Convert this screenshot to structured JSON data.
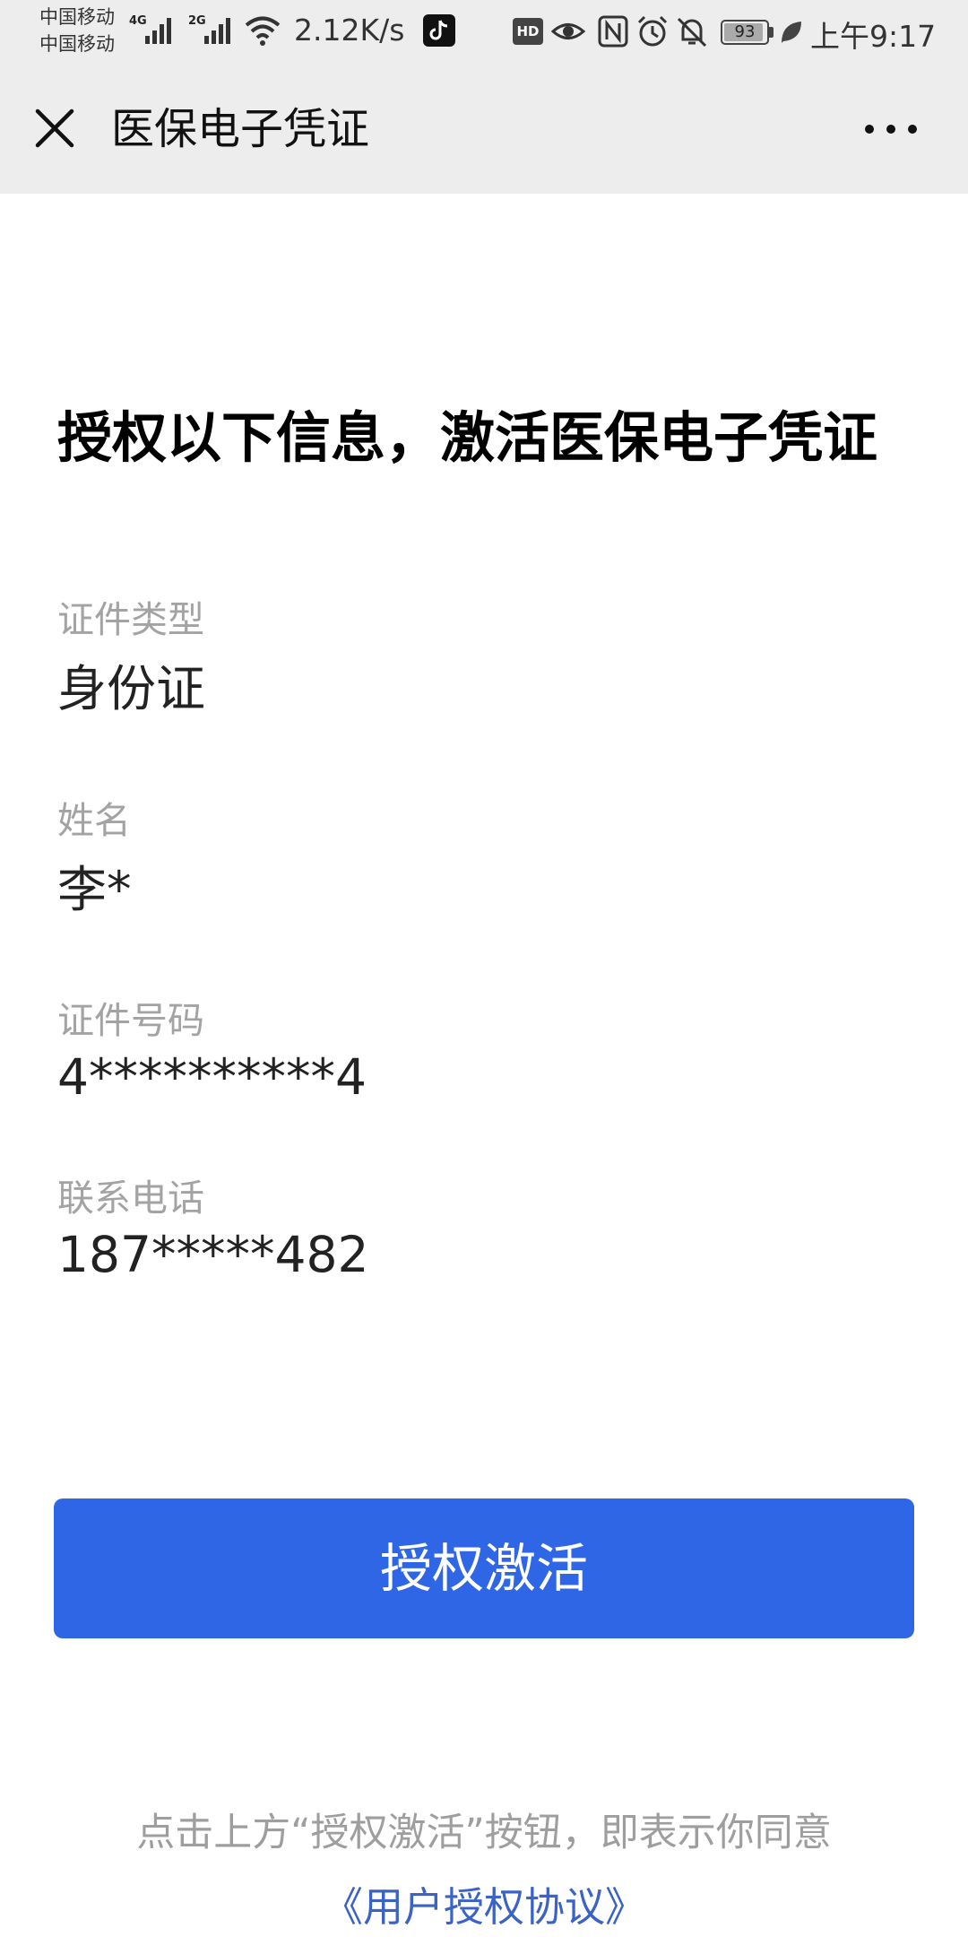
{
  "status_bar": {
    "carrier_1": "中国移动",
    "carrier_2": "中国移动",
    "network_1": "4G",
    "network_2": "2G",
    "speed": "2.12K/s",
    "hd_label": "HD",
    "battery_level": "93",
    "battery_fraction": 0.93,
    "time": "上午9:17",
    "icons": [
      "signal-icon",
      "wifi-icon",
      "tiktok-icon",
      "hd-icon",
      "eye-icon",
      "nfc-icon",
      "alarm-icon",
      "mute-icon",
      "battery-icon",
      "leaf-icon"
    ]
  },
  "nav": {
    "title": "医保电子凭证",
    "close_icon": "close-icon",
    "more_icon": "more-icon"
  },
  "main": {
    "heading": "授权以下信息，激活医保电子凭证",
    "fields": [
      {
        "label": "证件类型",
        "value": "身份证"
      },
      {
        "label": "姓名",
        "value": "李*"
      },
      {
        "label": "证件号码",
        "value": "4**********4"
      },
      {
        "label": "联系电话",
        "value": "187*****482"
      }
    ],
    "activate_button": "授权激活",
    "footer_text": "点击上方“授权激活”按钮，即表示你同意",
    "agreement_link": "《用户授权协议》"
  },
  "colors": {
    "primary": "#2f66e6",
    "link": "#3a63c5",
    "label_gray": "#a3a3a3",
    "header_bg": "#ededed"
  }
}
